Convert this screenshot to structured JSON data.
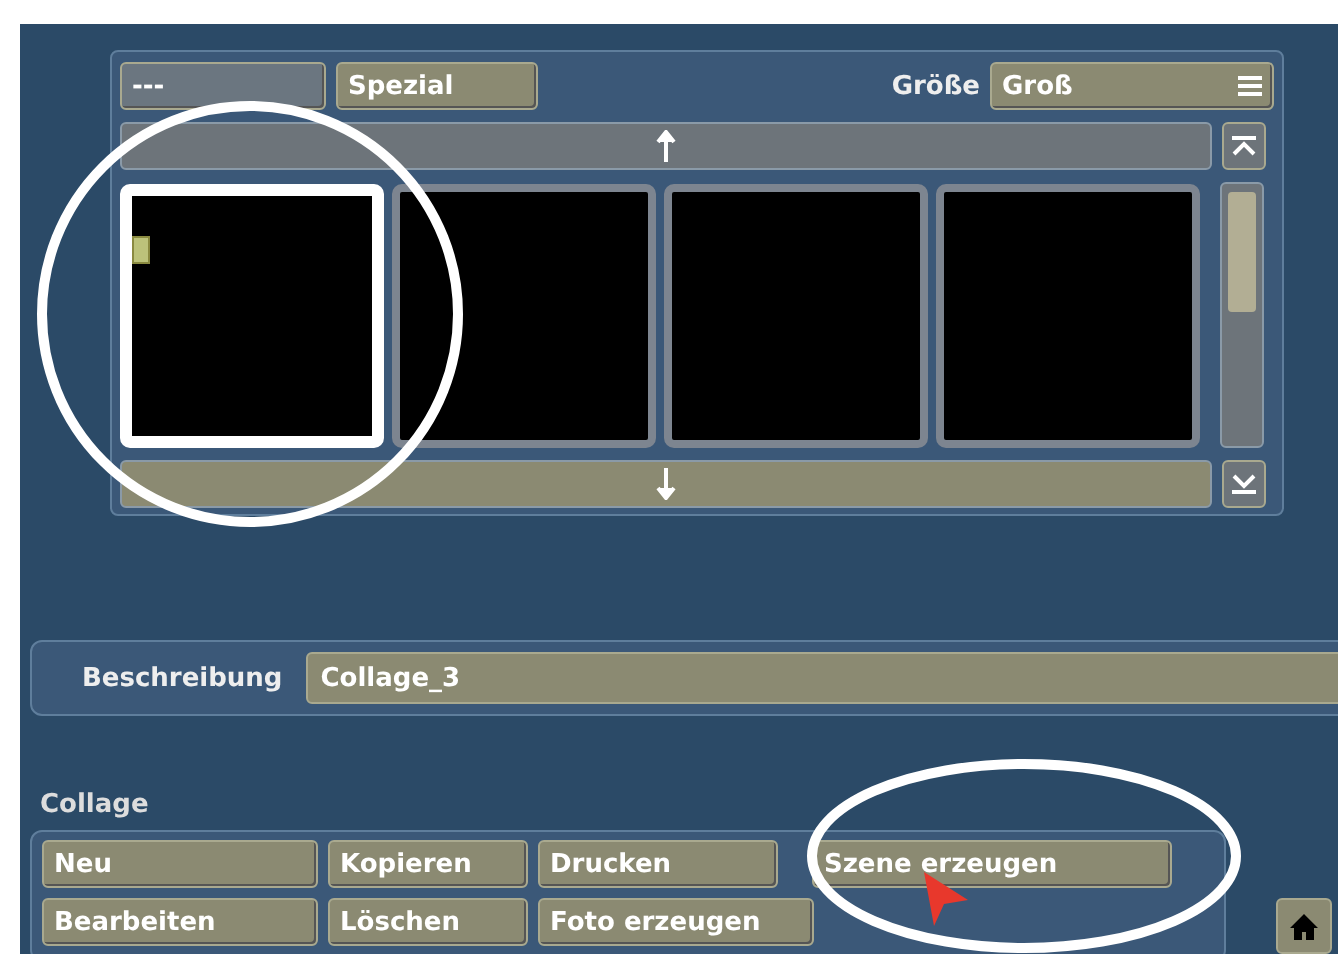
{
  "top_bar": {
    "left_button": "---",
    "filter_button": "Spezial",
    "size_label": "Größe",
    "size_value": "Groß"
  },
  "thumbnails": [
    {
      "selected": true,
      "has_marker": true
    },
    {
      "selected": false,
      "has_marker": false
    },
    {
      "selected": false,
      "has_marker": false
    },
    {
      "selected": false,
      "has_marker": false
    }
  ],
  "description": {
    "label": "Beschreibung",
    "value": "Collage_3"
  },
  "collage": {
    "title": "Collage",
    "buttons": [
      [
        "Neu",
        "Kopieren",
        "Drucken",
        "Szene erzeugen"
      ],
      [
        "Bearbeiten",
        "Löschen",
        "Foto erzeugen"
      ]
    ]
  }
}
